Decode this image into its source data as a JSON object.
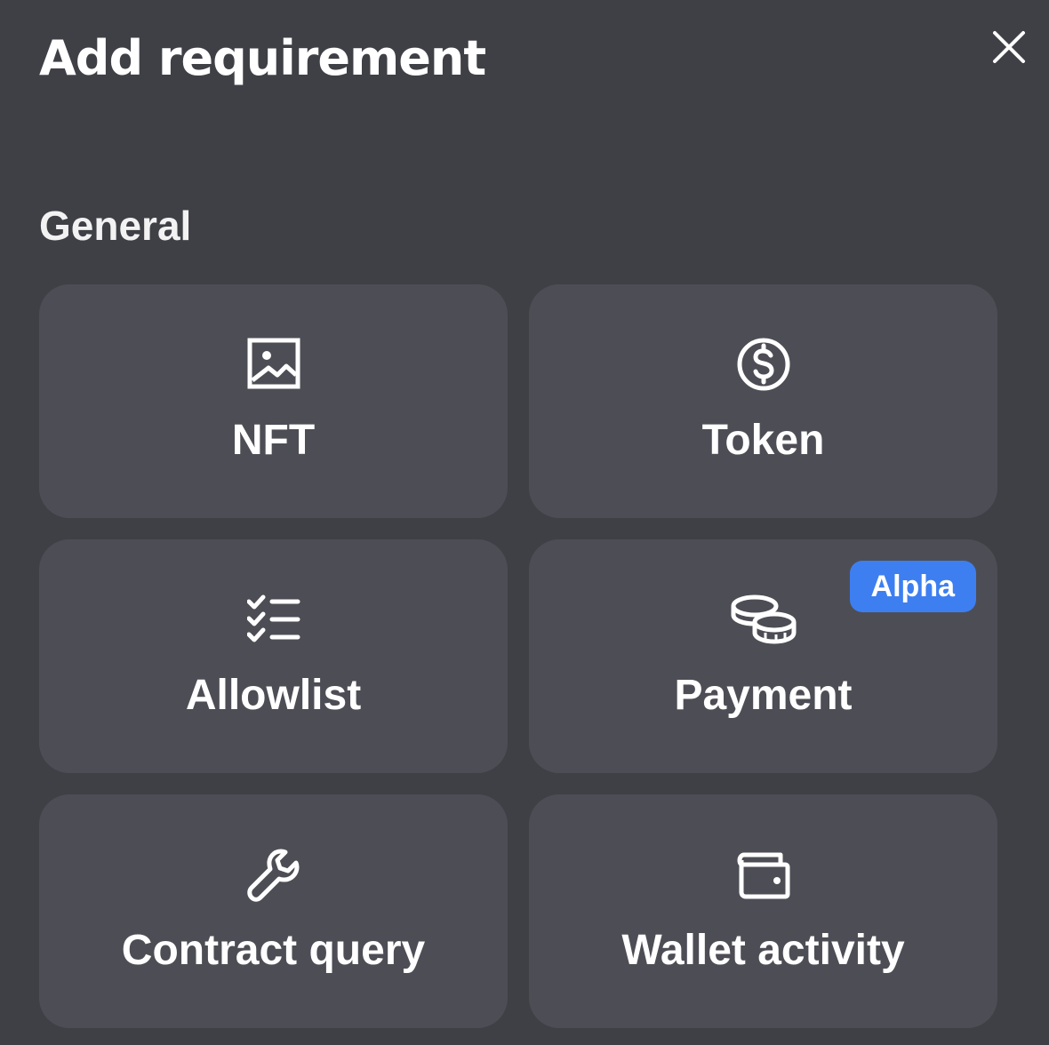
{
  "modal": {
    "title": "Add requirement",
    "close_icon": "close-icon"
  },
  "section": {
    "heading": "General"
  },
  "cards": [
    {
      "label": "NFT",
      "icon": "image-icon"
    },
    {
      "label": "Token",
      "icon": "dollar-circle-icon"
    },
    {
      "label": "Allowlist",
      "icon": "checklist-icon"
    },
    {
      "label": "Payment",
      "icon": "coins-icon",
      "badge": "Alpha"
    },
    {
      "label": "Contract query",
      "icon": "wrench-icon"
    },
    {
      "label": "Wallet activity",
      "icon": "wallet-icon"
    }
  ],
  "colors": {
    "background": "#3f4046",
    "card": "#4d4e55",
    "badge": "#3d7ff0",
    "text": "#ffffff"
  }
}
